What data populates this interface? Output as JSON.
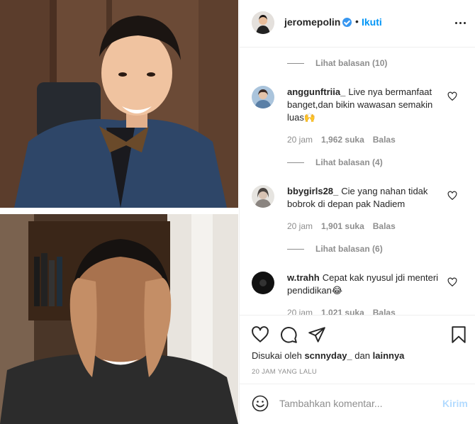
{
  "header": {
    "username": "jeromepolin",
    "separator": "•",
    "follow_label": "Ikuti",
    "more_icon": "more-horizontal-icon",
    "verified_color": "#3897f0"
  },
  "comments": [
    {
      "view_replies": "Lihat balasan (10)"
    },
    {
      "username": "anggunftriia_",
      "text": "Live nya bermanfaat banget,dan bikin wawasan semakin luas🙌",
      "time": "20 jam",
      "likes": "1,962 suka",
      "reply": "Balas",
      "view_replies": "Lihat balasan (4)"
    },
    {
      "username": "bbygirls28_",
      "text": "Cie yang nahan tidak bobrok di depan pak Nadiem",
      "time": "20 jam",
      "likes": "1,901 suka",
      "reply": "Balas",
      "view_replies": "Lihat balasan (6)"
    },
    {
      "username": "w.trahh",
      "text": "Cepat kak nyusul jdi menteri pendidikan😂",
      "time": "20 jam",
      "likes": "1,021 suka",
      "reply": "Balas"
    }
  ],
  "footer": {
    "liked_prefix": "Disukai oleh",
    "liked_user": "scnnyday_",
    "liked_and": "dan",
    "liked_others": "lainnya",
    "timeago": "20 JAM YANG LALU",
    "comment_placeholder": "Tambahkan komentar...",
    "post_label": "Kirim"
  },
  "colors": {
    "link_blue": "#0095f6",
    "post_disabled": "#b3dbff",
    "muted": "#8e8e8e"
  }
}
